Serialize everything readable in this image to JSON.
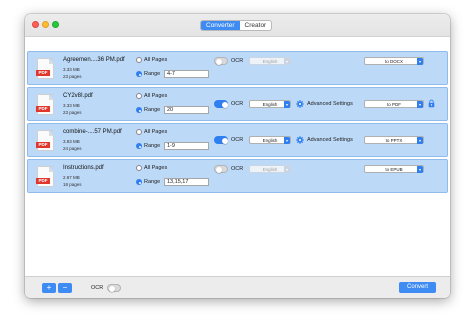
{
  "tabs": [
    {
      "label": "Converter",
      "active": true
    },
    {
      "label": "Creator",
      "active": false
    }
  ],
  "options": {
    "all_pages": "All Pages",
    "range": "Range",
    "ocr": "OCR",
    "advanced_settings": "Advanced Settings",
    "file_badge": "PDF"
  },
  "files": [
    {
      "name": "Agreemen....36 PM.pdf",
      "size": "3.33 MB",
      "pages": "23 pages",
      "range_value": "4-7",
      "ocr_on": false,
      "language": "English",
      "output": "to DOCX",
      "show_advanced": false
    },
    {
      "name": "CY2v8I.pdf",
      "size": "3.33 MB",
      "pages": "23 pages",
      "range_value": "20",
      "ocr_on": true,
      "language": "English",
      "output": "to PDF",
      "show_advanced": true
    },
    {
      "name": "combine-....57 PM.pdf",
      "size": "3.93 MB",
      "pages": "24 pages",
      "range_value": "1-9",
      "ocr_on": true,
      "language": "English",
      "output": "to PPTX",
      "show_advanced": true
    },
    {
      "name": "Instructions.pdf",
      "size": "2.97 MB",
      "pages": "18 pages",
      "range_value": "13,15,17",
      "ocr_on": false,
      "language": "English",
      "output": "to EPUB",
      "show_advanced": false
    }
  ],
  "bottom": {
    "add": "+",
    "remove": "−",
    "ocr_label": "OCR",
    "convert": "Convert"
  },
  "colors": {
    "accent": "#3d8bf3",
    "row_selected": "#bcd9f7",
    "pdf_badge": "#e0362c"
  }
}
